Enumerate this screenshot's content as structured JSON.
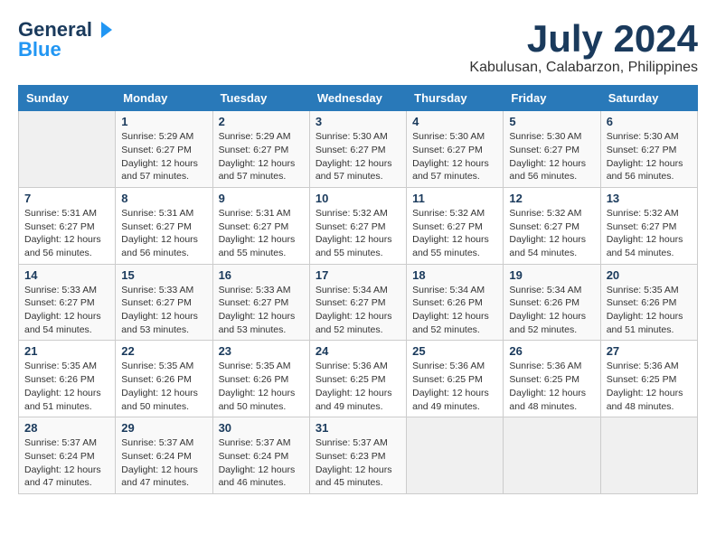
{
  "logo": {
    "line1": "General",
    "line2": "Blue",
    "tagline": ""
  },
  "title": "July 2024",
  "subtitle": "Kabulusan, Calabarzon, Philippines",
  "days_of_week": [
    "Sunday",
    "Monday",
    "Tuesday",
    "Wednesday",
    "Thursday",
    "Friday",
    "Saturday"
  ],
  "weeks": [
    [
      {
        "day": "",
        "info": ""
      },
      {
        "day": "1",
        "info": "Sunrise: 5:29 AM\nSunset: 6:27 PM\nDaylight: 12 hours\nand 57 minutes."
      },
      {
        "day": "2",
        "info": "Sunrise: 5:29 AM\nSunset: 6:27 PM\nDaylight: 12 hours\nand 57 minutes."
      },
      {
        "day": "3",
        "info": "Sunrise: 5:30 AM\nSunset: 6:27 PM\nDaylight: 12 hours\nand 57 minutes."
      },
      {
        "day": "4",
        "info": "Sunrise: 5:30 AM\nSunset: 6:27 PM\nDaylight: 12 hours\nand 57 minutes."
      },
      {
        "day": "5",
        "info": "Sunrise: 5:30 AM\nSunset: 6:27 PM\nDaylight: 12 hours\nand 56 minutes."
      },
      {
        "day": "6",
        "info": "Sunrise: 5:30 AM\nSunset: 6:27 PM\nDaylight: 12 hours\nand 56 minutes."
      }
    ],
    [
      {
        "day": "7",
        "info": "Sunrise: 5:31 AM\nSunset: 6:27 PM\nDaylight: 12 hours\nand 56 minutes."
      },
      {
        "day": "8",
        "info": "Sunrise: 5:31 AM\nSunset: 6:27 PM\nDaylight: 12 hours\nand 56 minutes."
      },
      {
        "day": "9",
        "info": "Sunrise: 5:31 AM\nSunset: 6:27 PM\nDaylight: 12 hours\nand 55 minutes."
      },
      {
        "day": "10",
        "info": "Sunrise: 5:32 AM\nSunset: 6:27 PM\nDaylight: 12 hours\nand 55 minutes."
      },
      {
        "day": "11",
        "info": "Sunrise: 5:32 AM\nSunset: 6:27 PM\nDaylight: 12 hours\nand 55 minutes."
      },
      {
        "day": "12",
        "info": "Sunrise: 5:32 AM\nSunset: 6:27 PM\nDaylight: 12 hours\nand 54 minutes."
      },
      {
        "day": "13",
        "info": "Sunrise: 5:32 AM\nSunset: 6:27 PM\nDaylight: 12 hours\nand 54 minutes."
      }
    ],
    [
      {
        "day": "14",
        "info": "Sunrise: 5:33 AM\nSunset: 6:27 PM\nDaylight: 12 hours\nand 54 minutes."
      },
      {
        "day": "15",
        "info": "Sunrise: 5:33 AM\nSunset: 6:27 PM\nDaylight: 12 hours\nand 53 minutes."
      },
      {
        "day": "16",
        "info": "Sunrise: 5:33 AM\nSunset: 6:27 PM\nDaylight: 12 hours\nand 53 minutes."
      },
      {
        "day": "17",
        "info": "Sunrise: 5:34 AM\nSunset: 6:27 PM\nDaylight: 12 hours\nand 52 minutes."
      },
      {
        "day": "18",
        "info": "Sunrise: 5:34 AM\nSunset: 6:26 PM\nDaylight: 12 hours\nand 52 minutes."
      },
      {
        "day": "19",
        "info": "Sunrise: 5:34 AM\nSunset: 6:26 PM\nDaylight: 12 hours\nand 52 minutes."
      },
      {
        "day": "20",
        "info": "Sunrise: 5:35 AM\nSunset: 6:26 PM\nDaylight: 12 hours\nand 51 minutes."
      }
    ],
    [
      {
        "day": "21",
        "info": "Sunrise: 5:35 AM\nSunset: 6:26 PM\nDaylight: 12 hours\nand 51 minutes."
      },
      {
        "day": "22",
        "info": "Sunrise: 5:35 AM\nSunset: 6:26 PM\nDaylight: 12 hours\nand 50 minutes."
      },
      {
        "day": "23",
        "info": "Sunrise: 5:35 AM\nSunset: 6:26 PM\nDaylight: 12 hours\nand 50 minutes."
      },
      {
        "day": "24",
        "info": "Sunrise: 5:36 AM\nSunset: 6:25 PM\nDaylight: 12 hours\nand 49 minutes."
      },
      {
        "day": "25",
        "info": "Sunrise: 5:36 AM\nSunset: 6:25 PM\nDaylight: 12 hours\nand 49 minutes."
      },
      {
        "day": "26",
        "info": "Sunrise: 5:36 AM\nSunset: 6:25 PM\nDaylight: 12 hours\nand 48 minutes."
      },
      {
        "day": "27",
        "info": "Sunrise: 5:36 AM\nSunset: 6:25 PM\nDaylight: 12 hours\nand 48 minutes."
      }
    ],
    [
      {
        "day": "28",
        "info": "Sunrise: 5:37 AM\nSunset: 6:24 PM\nDaylight: 12 hours\nand 47 minutes."
      },
      {
        "day": "29",
        "info": "Sunrise: 5:37 AM\nSunset: 6:24 PM\nDaylight: 12 hours\nand 47 minutes."
      },
      {
        "day": "30",
        "info": "Sunrise: 5:37 AM\nSunset: 6:24 PM\nDaylight: 12 hours\nand 46 minutes."
      },
      {
        "day": "31",
        "info": "Sunrise: 5:37 AM\nSunset: 6:23 PM\nDaylight: 12 hours\nand 45 minutes."
      },
      {
        "day": "",
        "info": ""
      },
      {
        "day": "",
        "info": ""
      },
      {
        "day": "",
        "info": ""
      }
    ]
  ]
}
